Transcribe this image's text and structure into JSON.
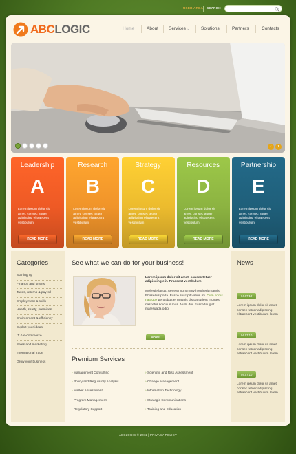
{
  "topbar": {
    "user_area": "USER AREA",
    "search": "SEARCH"
  },
  "logo": {
    "prefix": "ABC",
    "suffix": "LOGIC"
  },
  "nav": {
    "items": [
      "Home",
      "About",
      "Services",
      "Solutions",
      "Partners",
      "Contacts"
    ],
    "active": "Home"
  },
  "slider": {
    "dot_count": 5,
    "active_dot": 1
  },
  "cards": [
    {
      "title": "Leadership",
      "letter": "A",
      "text": "Lorem ipsum dolor sit amet, consec tetuer adipiscing elitraecent vestibulum",
      "button": "READ MORE",
      "color": "#ee5a25"
    },
    {
      "title": "Research",
      "letter": "B",
      "text": "Lorem ipsum dolor sit amet, consec tetuer adipiscing elitraecent vestibulum",
      "button": "READ MORE",
      "color": "#f0942a"
    },
    {
      "title": "Strategy",
      "letter": "C",
      "text": "Lorem ipsum dolor sit amet, consec tetuer adipiscing elitraecent vestibulum",
      "button": "READ MORE",
      "color": "#ecbb2e"
    },
    {
      "title": "Resources",
      "letter": "D",
      "text": "Lorem ipsum dolor sit amet, consec tetuer adipiscing elitraecent vestibulum",
      "button": "READ MORE",
      "color": "#8cb341"
    },
    {
      "title": "Partnership",
      "letter": "E",
      "text": "Lorem ipsum dolor sit amet, consec tetuer adipiscing elitraecent vestibulum",
      "button": "READ MORE",
      "color": "#1f5f7a"
    }
  ],
  "categories": {
    "title": "Categories",
    "items": [
      "Starting up",
      "Finance and grants",
      "Taxes, returns & payroll",
      "Employment & skills",
      "Health, safety, premises",
      "Environment & efficiency",
      "Exploit your ideas",
      "IT & e-commerce",
      "Sales and marketing",
      "International trade",
      "Grow your business"
    ]
  },
  "main": {
    "title": "See what we can do for your business!",
    "headline": "Lorem ipsum dolor sit amet, consec tetuer adipiscing elit. Praesent vestibulum",
    "body_pre": "Molestie lacus. Aenean nonummy hendrerit mauris. Phasellus porta. Fusce suscipit varius mi. ",
    "body_link": "Cum sociis natoque",
    "body_post": " penatibus et magnis dis parturient montes, nascetur ridiculus mus. Nulla dui. Fusce feugiat malesuada odio.",
    "more": "MORE"
  },
  "premium": {
    "title": "Premium Services",
    "left": [
      "Management Consulting",
      "Policy and Regulatory Analysis",
      "Market Assessment",
      "Program Management",
      "Regulatory Support"
    ],
    "right": [
      "Scientific and Risk Assessment",
      "Change Management",
      "Information Technology",
      "Strategic Communications",
      "Training and Education"
    ]
  },
  "news": {
    "title": "News",
    "items": [
      {
        "date": "04.07.10",
        "text": "Lorem ipsum dolor sit amet, consec tetuer adipiscing elitraecent vestibulum lorem"
      },
      {
        "date": "04.07.10",
        "text": "Lorem ipsum dolor sit amet, consec tetuer adipiscing elitraecent vestibulum lorem"
      },
      {
        "date": "04.07.10",
        "text": "Lorem ipsum dolor sit amet, consec tetuer adipiscing elitraecent vestibulum lorem"
      }
    ]
  },
  "footer": {
    "text": "ABCLOGIC © 2011 | PRIVACY POLICY"
  }
}
